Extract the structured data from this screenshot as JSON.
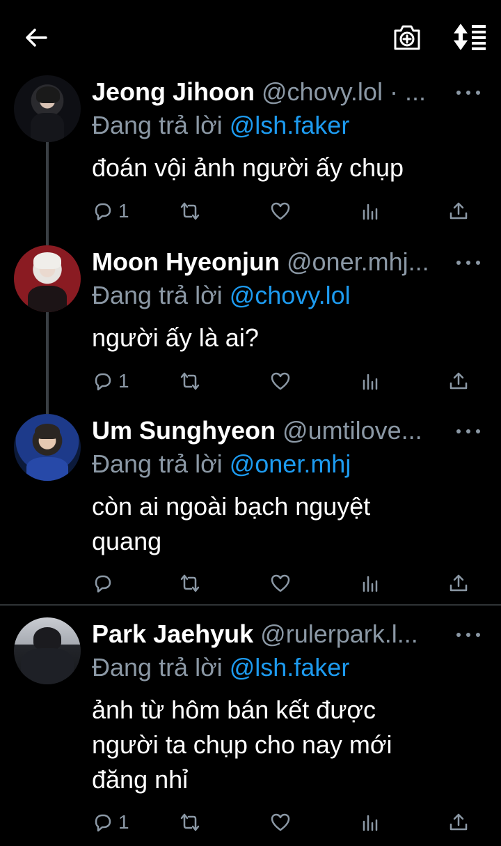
{
  "header": {
    "back_icon": "arrow-left-icon",
    "camera_icon": "camera-add-icon",
    "sort_icon": "sort-order-icon"
  },
  "colors": {
    "background": "#000000",
    "text": "#ffffff",
    "muted": "#8b98a5",
    "link": "#1d9bf0",
    "thread_line": "#3a3f44"
  },
  "tweets": [
    {
      "name": "Jeong Jihoon",
      "handle": "@chovy.lol · ...",
      "reply_prefix": "Đang trả lời",
      "reply_to": "@lsh.faker",
      "text": "đoán vội ảnh người ấy chụp",
      "reply_count": "1"
    },
    {
      "name": "Moon Hyeonjun",
      "handle": "@oner.mhj...",
      "reply_prefix": "Đang trả lời",
      "reply_to": "@chovy.lol",
      "text": "người ấy là ai?",
      "reply_count": "1"
    },
    {
      "name": "Um Sunghyeon",
      "handle": "@umtilove...",
      "reply_prefix": "Đang trả lời",
      "reply_to": "@oner.mhj",
      "text_lines": [
        "còn ai ngoài bạch nguyệt",
        "quang"
      ],
      "reply_count": ""
    },
    {
      "name": "Park Jaehyuk",
      "handle": "@rulerpark.l...",
      "reply_prefix": "Đang trả lời",
      "reply_to": "@lsh.faker",
      "text_lines": [
        "ảnh từ hôm bán kết được",
        "người ta chụp cho nay mới",
        "đăng nhỉ"
      ],
      "reply_count": "1"
    }
  ]
}
